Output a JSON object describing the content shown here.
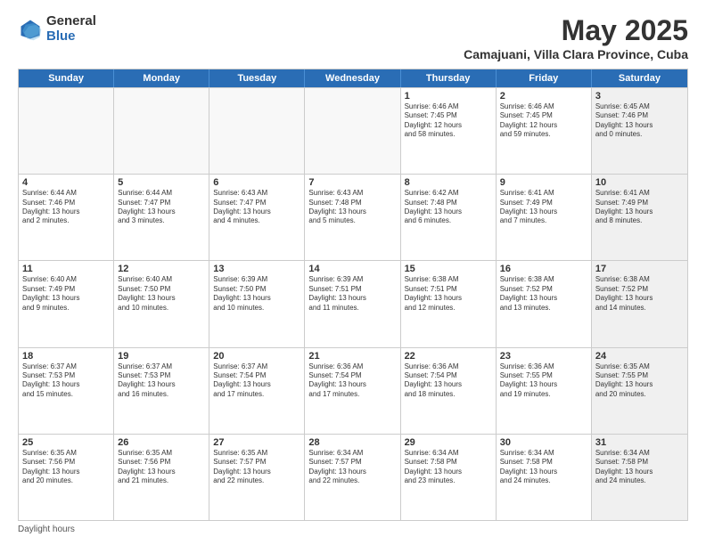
{
  "header": {
    "logo_general": "General",
    "logo_blue": "Blue",
    "title": "May 2025",
    "subtitle": "Camajuani, Villa Clara Province, Cuba"
  },
  "days_of_week": [
    "Sunday",
    "Monday",
    "Tuesday",
    "Wednesday",
    "Thursday",
    "Friday",
    "Saturday"
  ],
  "weeks": [
    [
      {
        "day": "",
        "info": "",
        "empty": true
      },
      {
        "day": "",
        "info": "",
        "empty": true
      },
      {
        "day": "",
        "info": "",
        "empty": true
      },
      {
        "day": "",
        "info": "",
        "empty": true
      },
      {
        "day": "1",
        "info": "Sunrise: 6:46 AM\nSunset: 7:45 PM\nDaylight: 12 hours\nand 58 minutes.",
        "empty": false
      },
      {
        "day": "2",
        "info": "Sunrise: 6:46 AM\nSunset: 7:45 PM\nDaylight: 12 hours\nand 59 minutes.",
        "empty": false
      },
      {
        "day": "3",
        "info": "Sunrise: 6:45 AM\nSunset: 7:46 PM\nDaylight: 13 hours\nand 0 minutes.",
        "empty": false,
        "shaded": true
      }
    ],
    [
      {
        "day": "4",
        "info": "Sunrise: 6:44 AM\nSunset: 7:46 PM\nDaylight: 13 hours\nand 2 minutes.",
        "empty": false
      },
      {
        "day": "5",
        "info": "Sunrise: 6:44 AM\nSunset: 7:47 PM\nDaylight: 13 hours\nand 3 minutes.",
        "empty": false
      },
      {
        "day": "6",
        "info": "Sunrise: 6:43 AM\nSunset: 7:47 PM\nDaylight: 13 hours\nand 4 minutes.",
        "empty": false
      },
      {
        "day": "7",
        "info": "Sunrise: 6:43 AM\nSunset: 7:48 PM\nDaylight: 13 hours\nand 5 minutes.",
        "empty": false
      },
      {
        "day": "8",
        "info": "Sunrise: 6:42 AM\nSunset: 7:48 PM\nDaylight: 13 hours\nand 6 minutes.",
        "empty": false
      },
      {
        "day": "9",
        "info": "Sunrise: 6:41 AM\nSunset: 7:49 PM\nDaylight: 13 hours\nand 7 minutes.",
        "empty": false
      },
      {
        "day": "10",
        "info": "Sunrise: 6:41 AM\nSunset: 7:49 PM\nDaylight: 13 hours\nand 8 minutes.",
        "empty": false,
        "shaded": true
      }
    ],
    [
      {
        "day": "11",
        "info": "Sunrise: 6:40 AM\nSunset: 7:49 PM\nDaylight: 13 hours\nand 9 minutes.",
        "empty": false
      },
      {
        "day": "12",
        "info": "Sunrise: 6:40 AM\nSunset: 7:50 PM\nDaylight: 13 hours\nand 10 minutes.",
        "empty": false
      },
      {
        "day": "13",
        "info": "Sunrise: 6:39 AM\nSunset: 7:50 PM\nDaylight: 13 hours\nand 10 minutes.",
        "empty": false
      },
      {
        "day": "14",
        "info": "Sunrise: 6:39 AM\nSunset: 7:51 PM\nDaylight: 13 hours\nand 11 minutes.",
        "empty": false
      },
      {
        "day": "15",
        "info": "Sunrise: 6:38 AM\nSunset: 7:51 PM\nDaylight: 13 hours\nand 12 minutes.",
        "empty": false
      },
      {
        "day": "16",
        "info": "Sunrise: 6:38 AM\nSunset: 7:52 PM\nDaylight: 13 hours\nand 13 minutes.",
        "empty": false
      },
      {
        "day": "17",
        "info": "Sunrise: 6:38 AM\nSunset: 7:52 PM\nDaylight: 13 hours\nand 14 minutes.",
        "empty": false,
        "shaded": true
      }
    ],
    [
      {
        "day": "18",
        "info": "Sunrise: 6:37 AM\nSunset: 7:53 PM\nDaylight: 13 hours\nand 15 minutes.",
        "empty": false
      },
      {
        "day": "19",
        "info": "Sunrise: 6:37 AM\nSunset: 7:53 PM\nDaylight: 13 hours\nand 16 minutes.",
        "empty": false
      },
      {
        "day": "20",
        "info": "Sunrise: 6:37 AM\nSunset: 7:54 PM\nDaylight: 13 hours\nand 17 minutes.",
        "empty": false
      },
      {
        "day": "21",
        "info": "Sunrise: 6:36 AM\nSunset: 7:54 PM\nDaylight: 13 hours\nand 17 minutes.",
        "empty": false
      },
      {
        "day": "22",
        "info": "Sunrise: 6:36 AM\nSunset: 7:54 PM\nDaylight: 13 hours\nand 18 minutes.",
        "empty": false
      },
      {
        "day": "23",
        "info": "Sunrise: 6:36 AM\nSunset: 7:55 PM\nDaylight: 13 hours\nand 19 minutes.",
        "empty": false
      },
      {
        "day": "24",
        "info": "Sunrise: 6:35 AM\nSunset: 7:55 PM\nDaylight: 13 hours\nand 20 minutes.",
        "empty": false,
        "shaded": true
      }
    ],
    [
      {
        "day": "25",
        "info": "Sunrise: 6:35 AM\nSunset: 7:56 PM\nDaylight: 13 hours\nand 20 minutes.",
        "empty": false
      },
      {
        "day": "26",
        "info": "Sunrise: 6:35 AM\nSunset: 7:56 PM\nDaylight: 13 hours\nand 21 minutes.",
        "empty": false
      },
      {
        "day": "27",
        "info": "Sunrise: 6:35 AM\nSunset: 7:57 PM\nDaylight: 13 hours\nand 22 minutes.",
        "empty": false
      },
      {
        "day": "28",
        "info": "Sunrise: 6:34 AM\nSunset: 7:57 PM\nDaylight: 13 hours\nand 22 minutes.",
        "empty": false
      },
      {
        "day": "29",
        "info": "Sunrise: 6:34 AM\nSunset: 7:58 PM\nDaylight: 13 hours\nand 23 minutes.",
        "empty": false
      },
      {
        "day": "30",
        "info": "Sunrise: 6:34 AM\nSunset: 7:58 PM\nDaylight: 13 hours\nand 24 minutes.",
        "empty": false
      },
      {
        "day": "31",
        "info": "Sunrise: 6:34 AM\nSunset: 7:58 PM\nDaylight: 13 hours\nand 24 minutes.",
        "empty": false,
        "shaded": true
      }
    ]
  ],
  "footer": {
    "note": "Daylight hours"
  },
  "colors": {
    "header_bg": "#2a6db5",
    "header_text": "#ffffff",
    "shaded_bg": "#f0f0f0",
    "border": "#cccccc"
  }
}
